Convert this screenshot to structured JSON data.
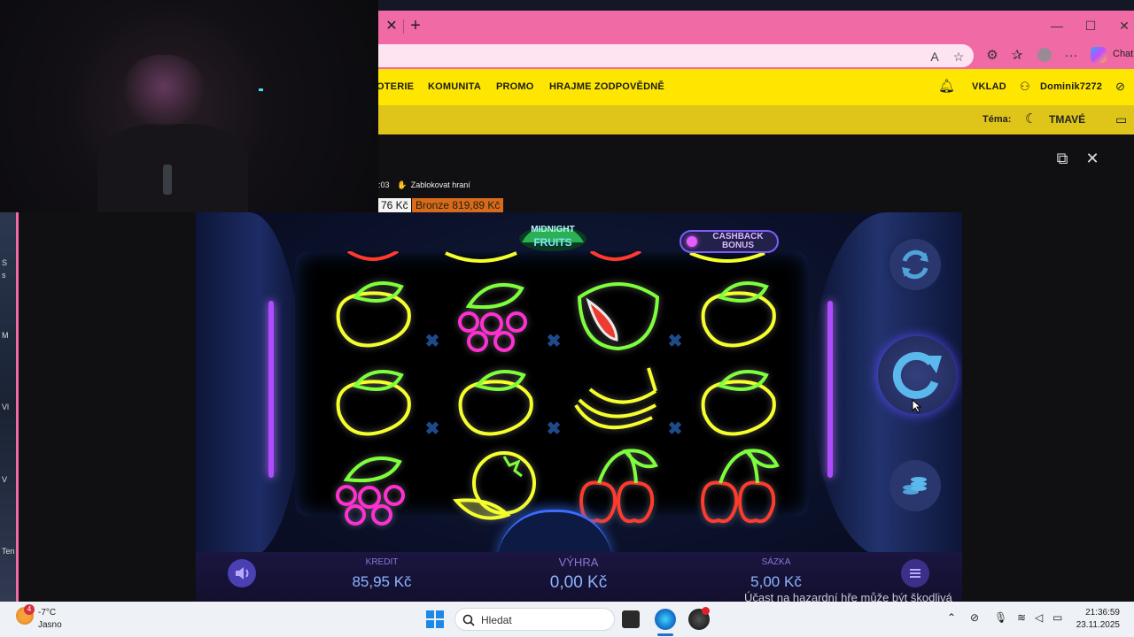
{
  "browser": {
    "window_controls": {
      "minimize": "—",
      "maximize": "☐",
      "close": "✕"
    },
    "new_tab_symbol": "+",
    "tab_close_symbol": "✕",
    "chat_label": "Chat"
  },
  "site_nav": {
    "items": [
      "OTERIE",
      "KOMUNITA",
      "PROMO",
      "HRAJME ZODPOVĚDNĚ"
    ],
    "deposit": "VKLAD",
    "username": "Dominik7272"
  },
  "theme_bar": {
    "label": "Téma:",
    "value": "TMAVÉ"
  },
  "stream_info": {
    "time_fragment": ":03",
    "block_label": "Zablokovat hraní"
  },
  "balances": {
    "credit_fragment": "76 Kč",
    "bronze": "Bronze 819,89 Kč"
  },
  "game": {
    "logo_line1": "MIDNIGHT",
    "logo_line2": "FRUITS",
    "cashback_line1": "CASHBACK",
    "cashback_line2": "BONUS",
    "reels": [
      [
        "lemon",
        "lemon",
        "grapes"
      ],
      [
        "grapes",
        "lemon",
        "orange"
      ],
      [
        "watermelon",
        "banana",
        "cherries"
      ],
      [
        "lemon",
        "lemon",
        "cherries"
      ]
    ],
    "bar": {
      "credit_label": "KREDIT",
      "credit_value": "85,95 Kč",
      "win_label": "VÝHRA",
      "win_value": "0,00 Kč",
      "bet_label": "SÁZKA",
      "bet_value": "5,00 Kč"
    },
    "warning": "Účast na hazardní hře může být škodlivá"
  },
  "desktop_labels": [
    "S",
    "s",
    "M",
    "Vl",
    "V",
    "Ten"
  ],
  "taskbar": {
    "weather_badge": "4",
    "weather_temp": "-7°C",
    "weather_cond": "Jasno",
    "search_placeholder": "Hledat",
    "time": "21:36:59",
    "date": "23.11.2025"
  },
  "colors": {
    "tab_pink": "#f06aa6",
    "site_yellow": "#ffe600",
    "neon_green": "#7dff3a",
    "neon_yellow": "#f5ff2a",
    "neon_pink": "#ff2fd2",
    "neon_red": "#ff3a2e"
  }
}
